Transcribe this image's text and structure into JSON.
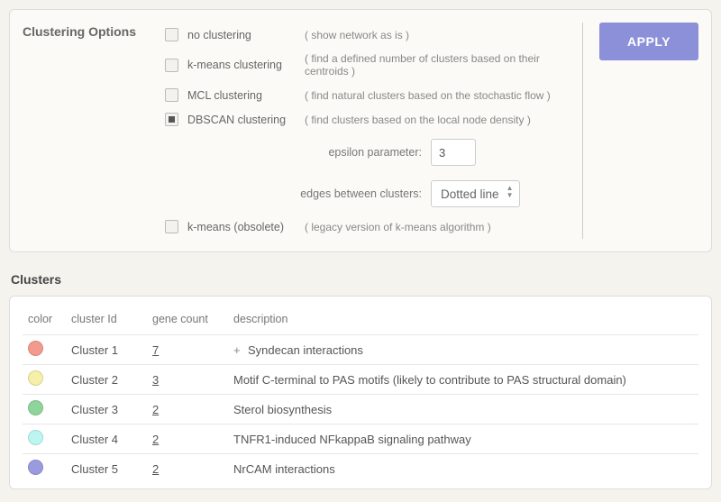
{
  "panel": {
    "title": "Clustering Options",
    "apply": "APPLY",
    "options": [
      {
        "label": "no clustering",
        "desc": "( show network as is )",
        "checked": false
      },
      {
        "label": "k-means clustering",
        "desc": "( find a defined number of clusters based on their centroids )",
        "checked": false
      },
      {
        "label": "MCL clustering",
        "desc": "( find natural clusters based on the stochastic flow )",
        "checked": false
      },
      {
        "label": "DBSCAN clustering",
        "desc": "( find clusters based on the local node density )",
        "checked": true
      },
      {
        "label": "k-means (obsolete)",
        "desc": "( legacy version of k-means algorithm )",
        "checked": false
      }
    ],
    "epsilon": {
      "label": "epsilon parameter:",
      "value": "3"
    },
    "edges": {
      "label": "edges between clusters:",
      "value": "Dotted line"
    }
  },
  "clusters_heading": "Clusters",
  "table": {
    "headers": {
      "color": "color",
      "id": "cluster Id",
      "count": "gene count",
      "desc": "description"
    },
    "rows": [
      {
        "color": "#f39a8e",
        "id": "Cluster 1",
        "count": "7",
        "expand": true,
        "desc": "Syndecan interactions"
      },
      {
        "color": "#f4f0a7",
        "id": "Cluster 2",
        "count": "3",
        "expand": false,
        "desc": "Motif C-terminal to PAS motifs (likely to contribute to PAS structural domain)"
      },
      {
        "color": "#8fd49a",
        "id": "Cluster 3",
        "count": "2",
        "expand": false,
        "desc": "Sterol biosynthesis"
      },
      {
        "color": "#bdf5f1",
        "id": "Cluster 4",
        "count": "2",
        "expand": false,
        "desc": "TNFR1-induced NFkappaB signaling pathway"
      },
      {
        "color": "#9a9ade",
        "id": "Cluster 5",
        "count": "2",
        "expand": false,
        "desc": "NrCAM interactions"
      }
    ]
  }
}
